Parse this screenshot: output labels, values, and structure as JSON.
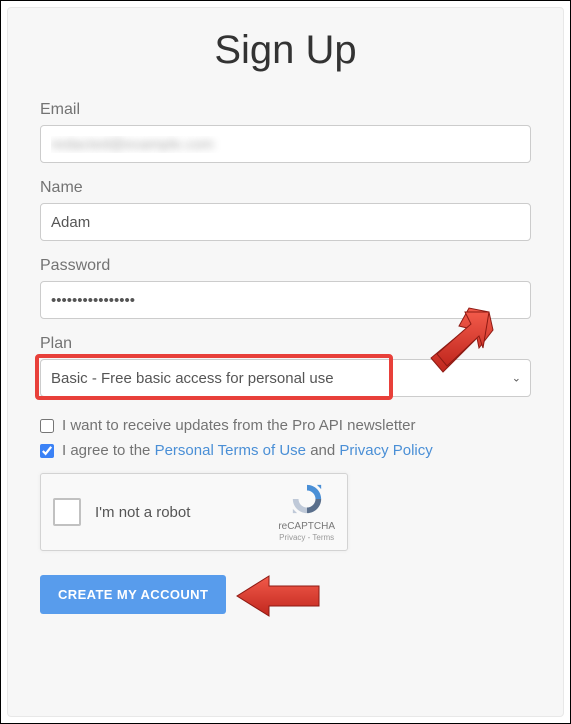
{
  "title": "Sign Up",
  "form": {
    "email": {
      "label": "Email",
      "value": "redacted@example.com"
    },
    "name": {
      "label": "Name",
      "value": "Adam"
    },
    "password": {
      "label": "Password",
      "value": "••••••••••••••••"
    },
    "plan": {
      "label": "Plan",
      "selected": "Basic - Free basic access for personal use"
    }
  },
  "options": {
    "newsletter": {
      "label": "I want to receive updates from the Pro API newsletter",
      "checked": false
    },
    "agree": {
      "prefix": "I agree to the ",
      "terms_link": "Personal Terms of Use",
      "and": " and ",
      "privacy_link": "Privacy Policy",
      "checked": true
    }
  },
  "recaptcha": {
    "label": "I'm not a robot",
    "brand": "reCAPTCHA",
    "footer": "Privacy - Terms"
  },
  "submit_label": "Create my account"
}
